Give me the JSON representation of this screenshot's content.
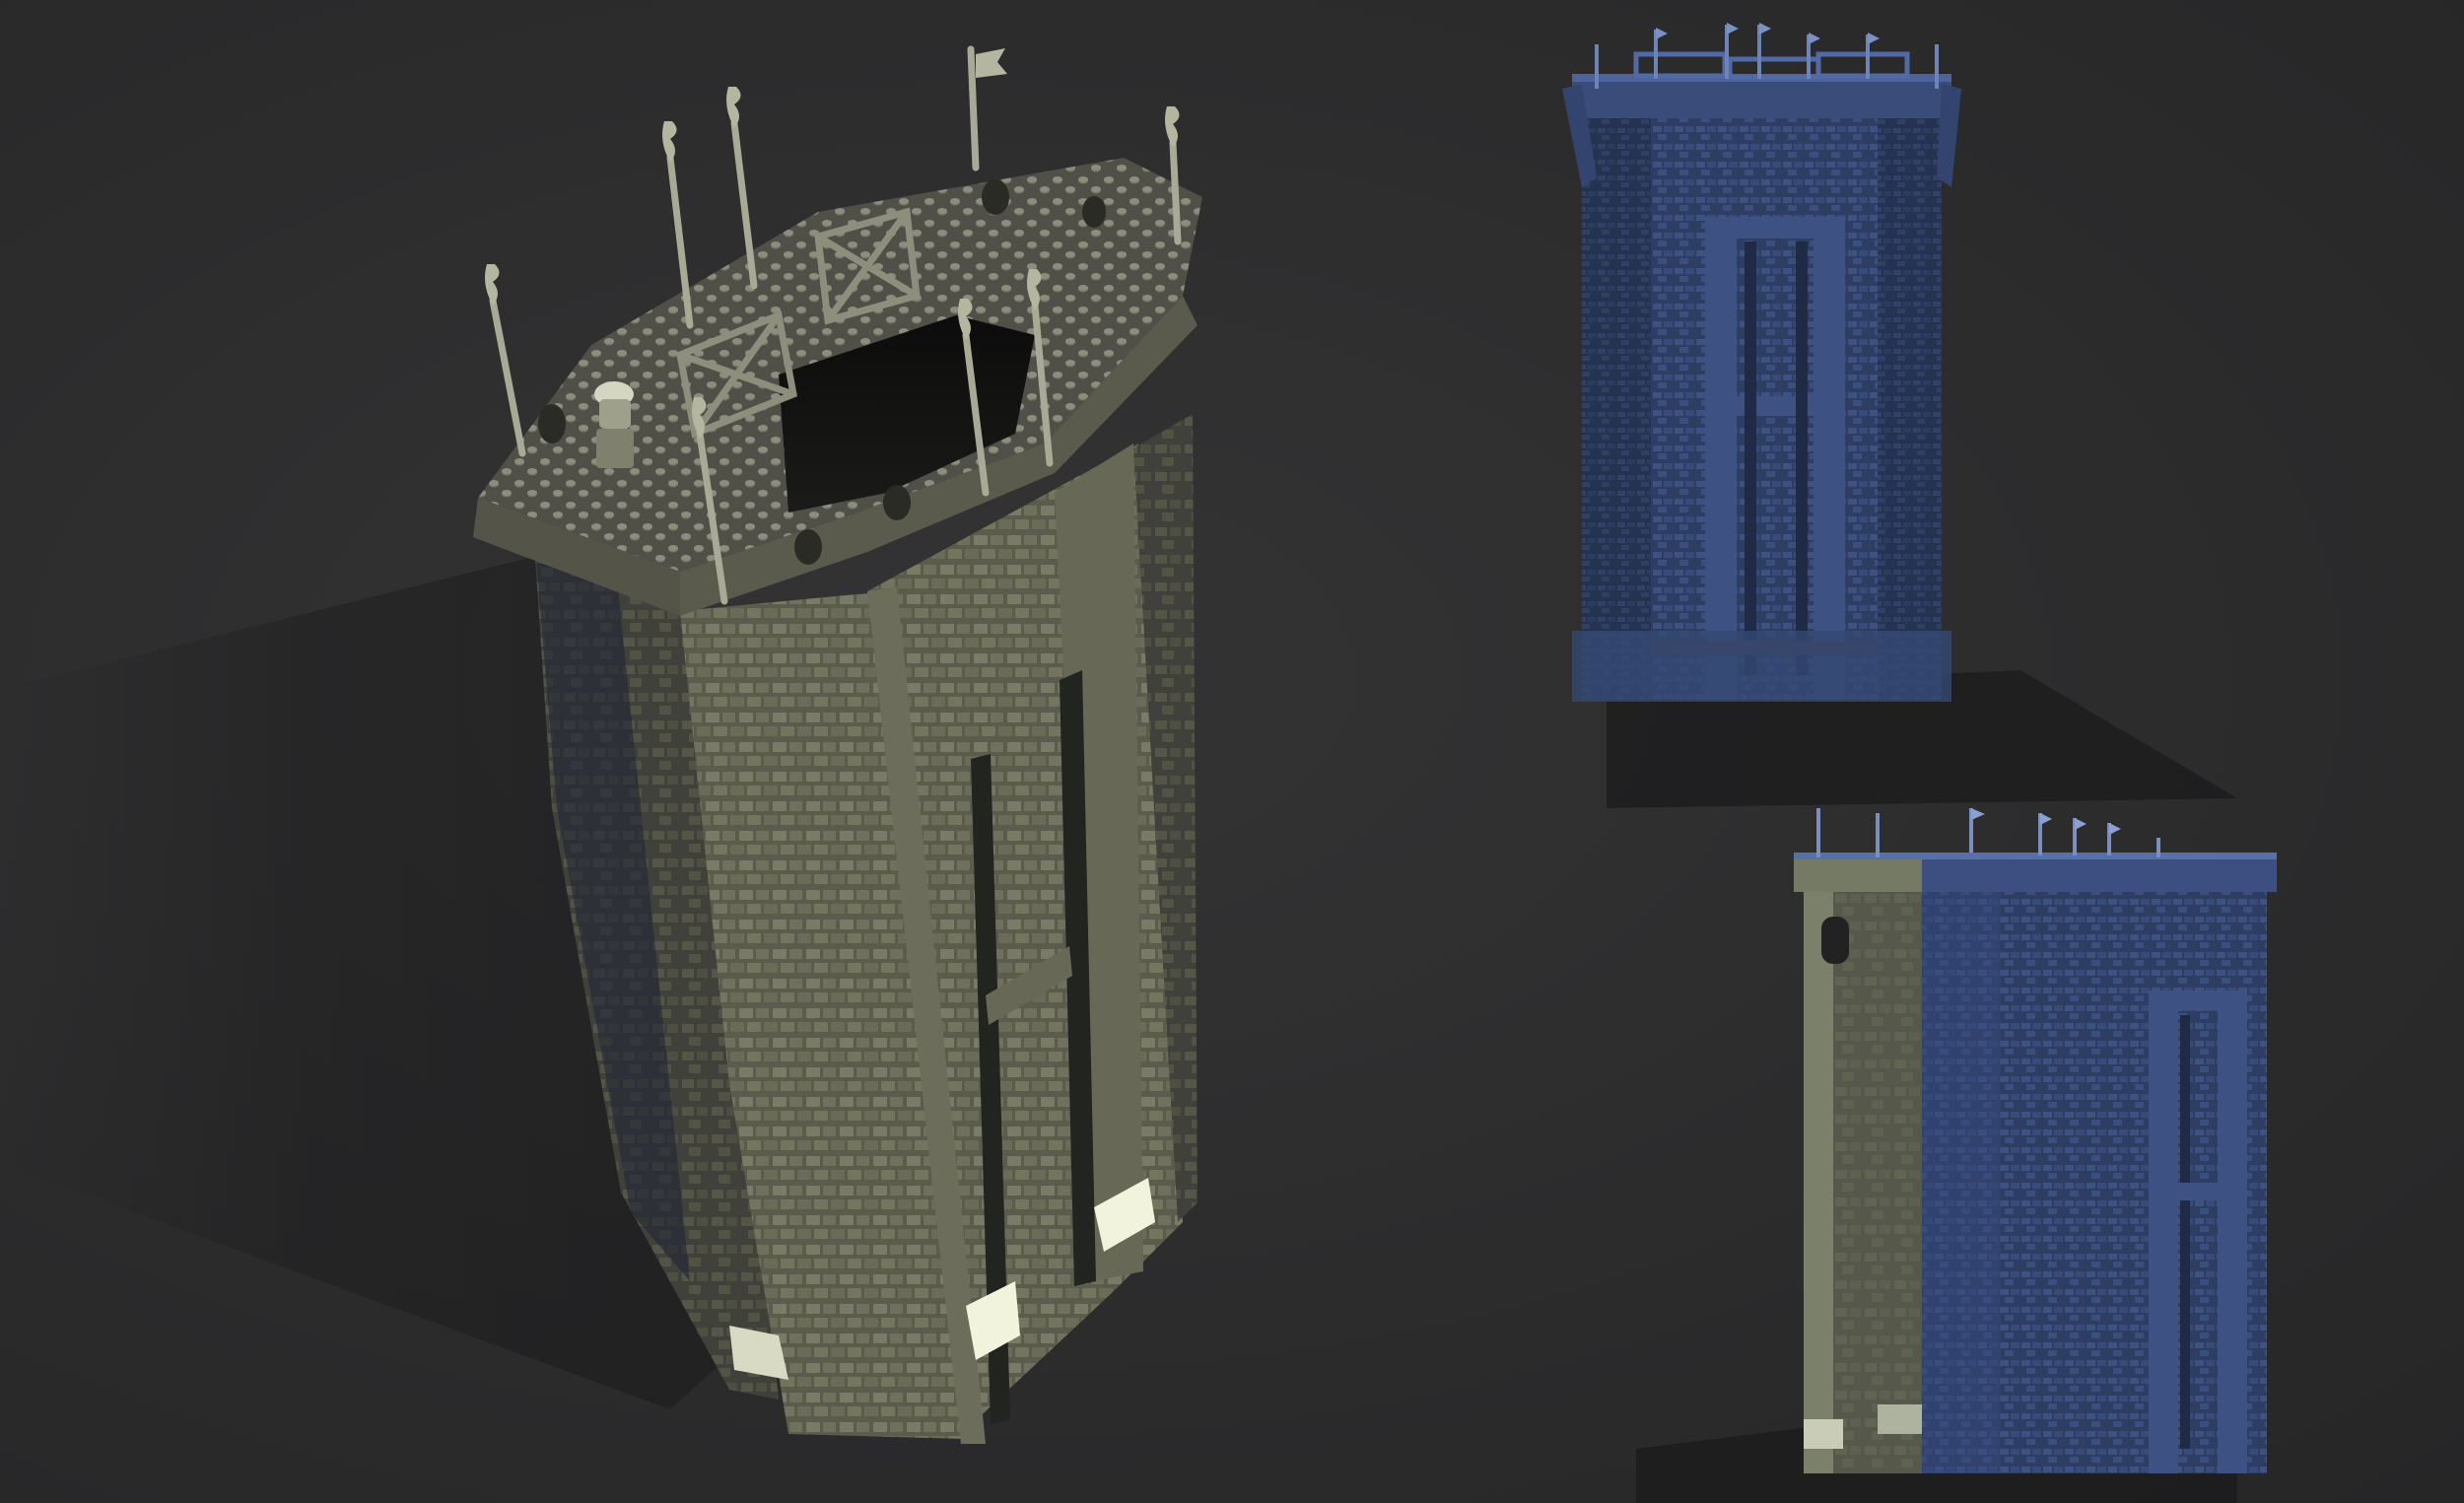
{
  "scene": {
    "background_color": "#2b2b2c",
    "views": [
      {
        "id": "perspective",
        "model": "stone-tower",
        "material_color": "#6e6f5c",
        "highlight_color": "#eef0d8"
      },
      {
        "id": "front",
        "model": "stone-tower",
        "material_color": "#3a4d7a"
      },
      {
        "id": "side",
        "model": "stone-tower",
        "material_color": "#3a4f82"
      }
    ]
  }
}
